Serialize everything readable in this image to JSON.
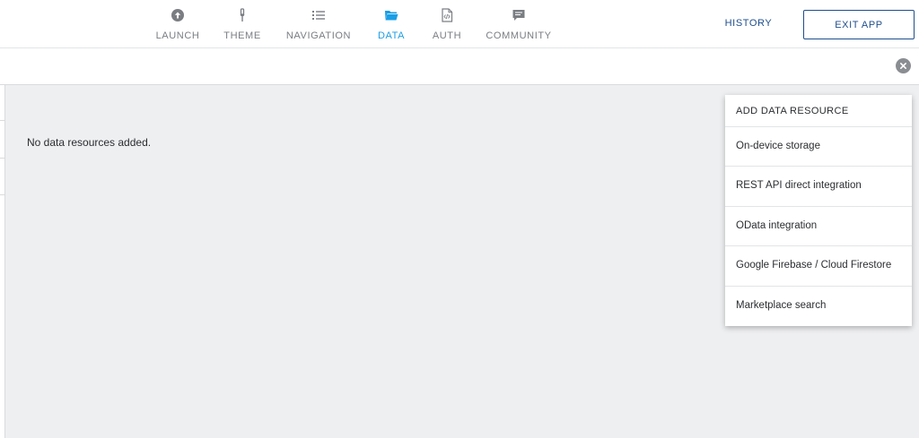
{
  "nav": {
    "tabs": [
      {
        "label": "LAUNCH",
        "icon": "arrow-up-circle-icon"
      },
      {
        "label": "THEME",
        "icon": "brush-icon"
      },
      {
        "label": "NAVIGATION",
        "icon": "list-icon"
      },
      {
        "label": "DATA",
        "icon": "folder-icon",
        "active": true
      },
      {
        "label": "AUTH",
        "icon": "code-file-icon"
      },
      {
        "label": "COMMUNITY",
        "icon": "chat-icon"
      }
    ],
    "active_color": "#1a9ee6",
    "inactive_color": "#7a7d82"
  },
  "header": {
    "history_label": "HISTORY",
    "exit_label": "EXIT APP",
    "accent_color": "#1f4e8c"
  },
  "main": {
    "empty_message": "No data resources added."
  },
  "dropdown": {
    "title": "ADD DATA RESOURCE",
    "items": [
      {
        "label": "On-device storage"
      },
      {
        "label": "REST API direct integration"
      },
      {
        "label": "OData integration"
      },
      {
        "label": "Google Firebase / Cloud Firestore"
      },
      {
        "label": "Marketplace search"
      }
    ]
  }
}
